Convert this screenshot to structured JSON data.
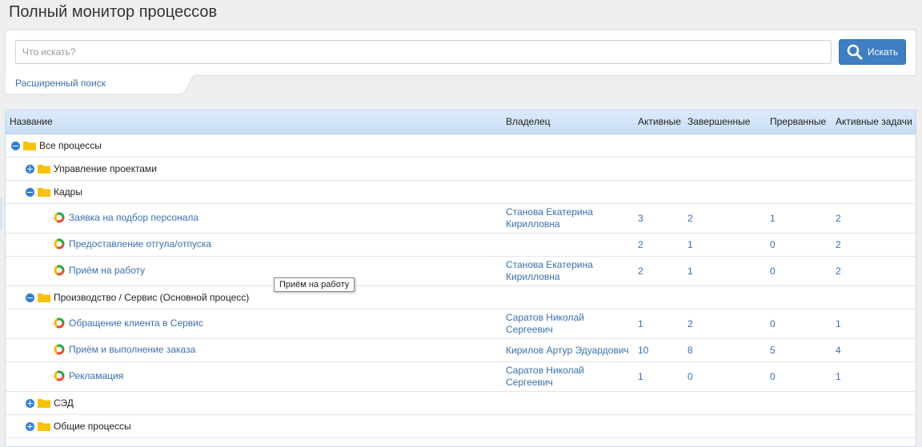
{
  "page": {
    "title": "Полный монитор процессов"
  },
  "search": {
    "placeholder": "Что искать?",
    "value": "",
    "button_label": "Искать",
    "advanced_link": "Расширенный поиск"
  },
  "colors": {
    "accent": "#3f7ec1",
    "link": "#3a6fb0",
    "folder": "#f7c20a",
    "header_bg": "#cfe2f8"
  },
  "table": {
    "columns": {
      "name": "Название",
      "owner": "Владелец",
      "active": "Активные",
      "completed": "Завершенные",
      "interrupted": "Прерванные",
      "active_tasks": "Активные задачи"
    },
    "rows": [
      {
        "kind": "folder",
        "toggle": "minus",
        "label": "Все процессы"
      },
      {
        "kind": "folder",
        "toggle": "plus",
        "label": "Управление проектами"
      },
      {
        "kind": "folder",
        "toggle": "minus",
        "label": "Кадры"
      },
      {
        "kind": "process",
        "label": "Заявка на подбор персонала",
        "owner_line1": "Станова Екатерина",
        "owner_line2": "Кирилловна",
        "active": "3",
        "completed": "2",
        "interrupted": "1",
        "active_tasks": "2"
      },
      {
        "kind": "process",
        "label": "Предоставление отгула/отпуска",
        "owner_line1": "",
        "owner_line2": "",
        "active": "2",
        "completed": "1",
        "interrupted": "0",
        "active_tasks": "2"
      },
      {
        "kind": "process",
        "label": "Приём на работу",
        "owner_line1": "Станова Екатерина",
        "owner_line2": "Кирилловна",
        "active": "2",
        "completed": "1",
        "interrupted": "0",
        "active_tasks": "2"
      },
      {
        "kind": "folder",
        "toggle": "minus",
        "label": "Производство / Сервис (Основной процесс)"
      },
      {
        "kind": "process",
        "label": "Обращение клиента в Сервис",
        "owner_line1": "Саратов Николай",
        "owner_line2": "Сергеевич",
        "active": "1",
        "completed": "2",
        "interrupted": "0",
        "active_tasks": "1"
      },
      {
        "kind": "process",
        "label": "Приём и выполнение заказа",
        "owner_line1": "Кирилов Артур Эдуардович",
        "owner_line2": "",
        "active": "10",
        "completed": "8",
        "interrupted": "5",
        "active_tasks": "4"
      },
      {
        "kind": "process",
        "label": "Рекламация",
        "owner_line1": "Саратов Николай",
        "owner_line2": "Сергеевич",
        "active": "1",
        "completed": "0",
        "interrupted": "0",
        "active_tasks": "1"
      },
      {
        "kind": "folder",
        "toggle": "plus",
        "label": "СЭД"
      },
      {
        "kind": "folder",
        "toggle": "plus",
        "label": "Общие процессы"
      }
    ]
  },
  "tooltip": {
    "text": "Приём на работу"
  }
}
